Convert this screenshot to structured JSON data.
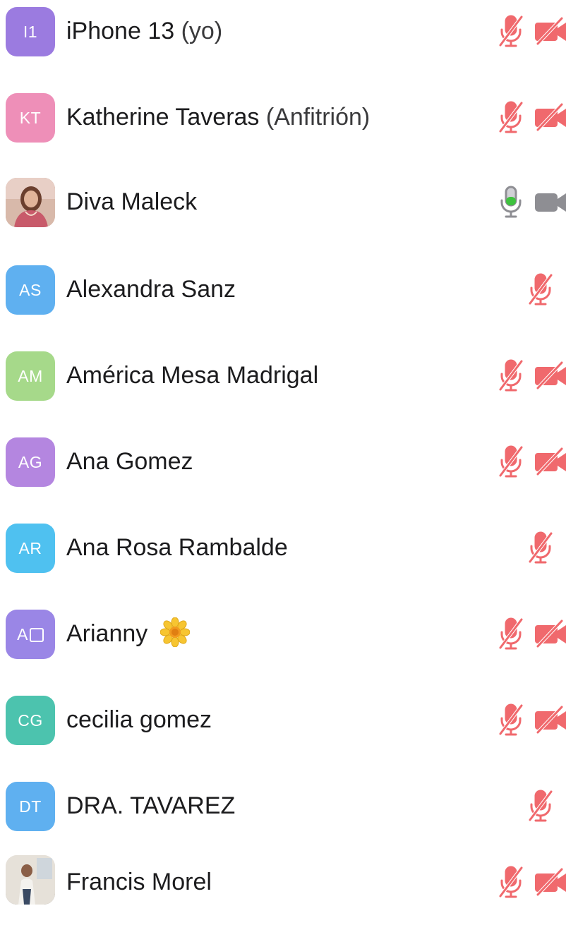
{
  "participants": [
    {
      "initials": "I1",
      "name": "iPhone 13",
      "suffix": " (yo)",
      "avatar_color": "#9b7be0",
      "mic": "muted",
      "video": "off"
    },
    {
      "initials": "KT",
      "name": "Katherine Taveras",
      "suffix": " (Anfitrión)",
      "avatar_color": "#ee8fb8",
      "mic": "muted",
      "video": "off"
    },
    {
      "initials": "",
      "name": "Diva Maleck",
      "suffix": "",
      "avatar_color": "#b88a76",
      "mic": "active",
      "video": "on"
    },
    {
      "initials": "AS",
      "name": "Alexandra Sanz",
      "suffix": "",
      "avatar_color": "#5fb0f0",
      "mic": "muted",
      "video": "none"
    },
    {
      "initials": "AM",
      "name": "América Mesa Madrigal",
      "suffix": "",
      "avatar_color": "#a6d98a",
      "mic": "muted",
      "video": "off"
    },
    {
      "initials": "AG",
      "name": "Ana Gomez",
      "suffix": "",
      "avatar_color": "#b486e0",
      "mic": "muted",
      "video": "off"
    },
    {
      "initials": "AR",
      "name": "Ana Rosa Rambalde",
      "suffix": "",
      "avatar_color": "#4fc1f0",
      "mic": "muted",
      "video": "none"
    },
    {
      "initials": "A",
      "name": "Arianny",
      "suffix": "",
      "avatar_color": "#9a86e6",
      "mic": "muted",
      "video": "off"
    },
    {
      "initials": "CG",
      "name": "cecilia gomez",
      "suffix": "",
      "avatar_color": "#4cc3ae",
      "mic": "muted",
      "video": "off"
    },
    {
      "initials": "DT",
      "name": "DRA. TAVAREZ",
      "suffix": "",
      "avatar_color": "#5fb0f0",
      "mic": "muted",
      "video": "none"
    },
    {
      "initials": "",
      "name": "Francis Morel",
      "suffix": "",
      "avatar_color": "#cfc7bd",
      "mic": "muted",
      "video": "off"
    }
  ],
  "icons": {
    "mic_muted": "mic-muted-icon",
    "mic_active": "mic-active-icon",
    "video_off": "video-off-icon",
    "video_on": "video-on-icon",
    "flower": "sunflower-emoji-icon"
  },
  "colors": {
    "muted_red": "#f0696d",
    "active_green": "#3ec23e",
    "neutral_gray": "#8e8e93"
  }
}
